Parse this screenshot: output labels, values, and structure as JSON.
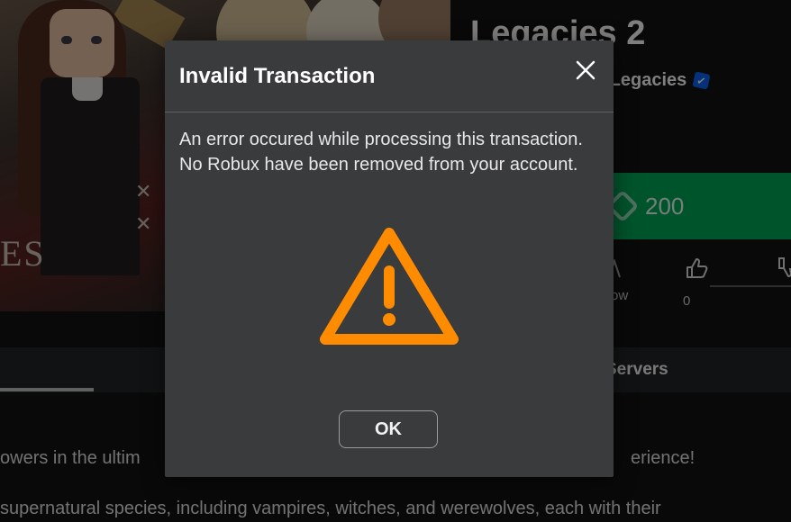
{
  "game": {
    "title": "Legacies 2",
    "creator": "e Legacies",
    "price": "200",
    "follow_label": "ow",
    "likes": "0",
    "tab_servers": "Servers",
    "thumb_logo": "ES",
    "description_line1": "owers in the ultim",
    "description_line1_end": "erience!",
    "description_line2": "supernatural species, including vampires, witches, and werewolves, each with their"
  },
  "modal": {
    "title": "Invalid Transaction",
    "message": "An error occured while processing this transaction. No Robux have been removed from your account.",
    "ok_label": "OK"
  },
  "colors": {
    "warning": "#ff8c00",
    "buy_button": "#00a858",
    "modal_bg": "#393b3d",
    "verified": "#0b62f5"
  },
  "icons": {
    "close": "close-icon",
    "warning": "warning-icon",
    "robux": "robux-icon",
    "verified": "verified-badge-icon",
    "like": "thumbs-up-icon",
    "dislike": "thumbs-down-icon"
  }
}
